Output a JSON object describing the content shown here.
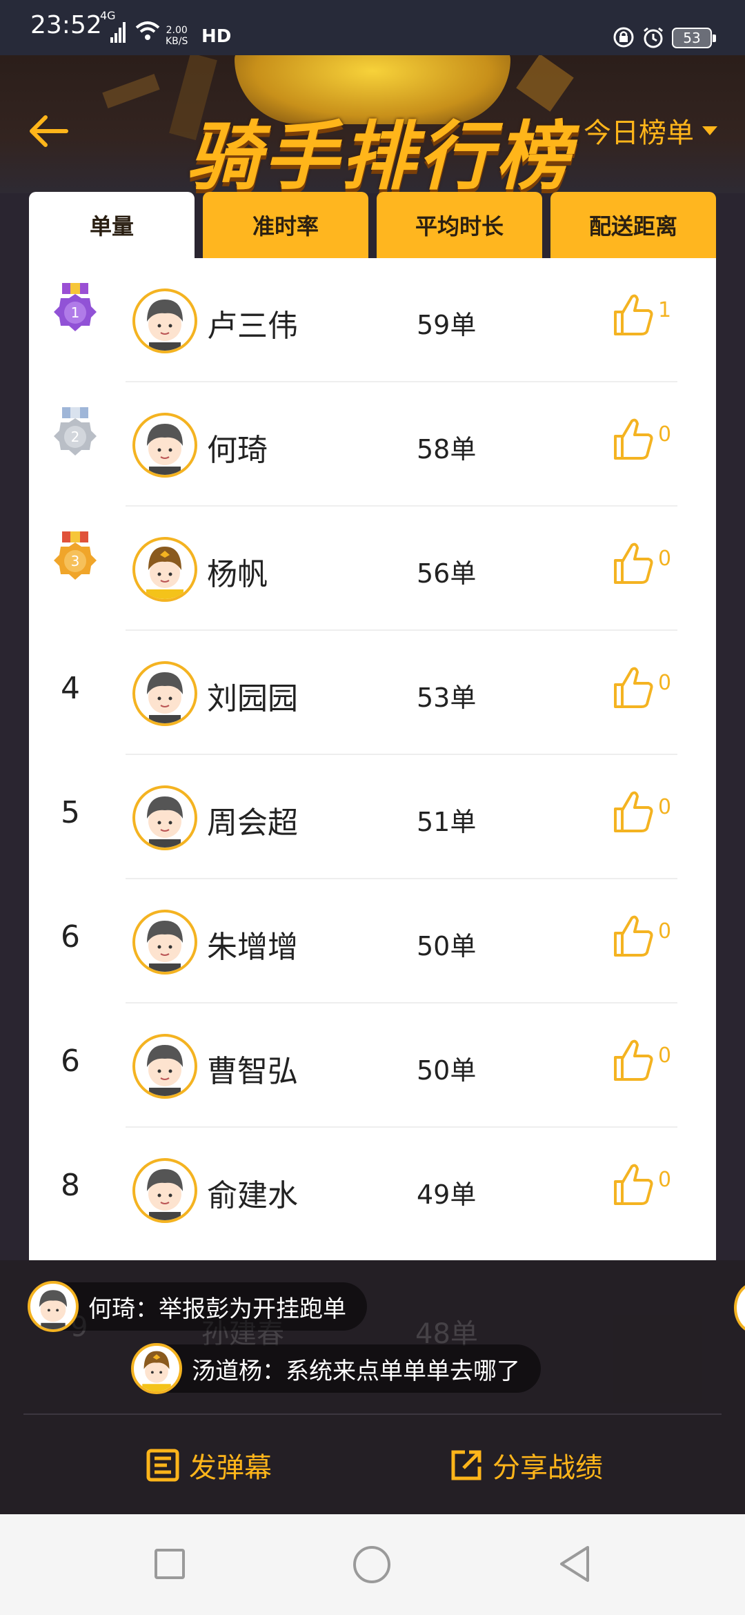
{
  "status_bar": {
    "time": "23:52",
    "network": "4G",
    "speed_value": "2.00",
    "speed_unit": "KB/S",
    "hd": "HD",
    "battery": "53"
  },
  "header": {
    "title": "骑手排行榜",
    "period_dropdown": "今日榜单"
  },
  "tabs": [
    {
      "label": "单量",
      "active": true
    },
    {
      "label": "准时率",
      "active": false
    },
    {
      "label": "平均时长",
      "active": false
    },
    {
      "label": "配送距离",
      "active": false
    }
  ],
  "riders": [
    {
      "rank": "1",
      "medal": "purple",
      "name": "卢三伟",
      "orders": "59单",
      "likes": "1"
    },
    {
      "rank": "2",
      "medal": "silver",
      "name": "何琦",
      "orders": "58单",
      "likes": "0"
    },
    {
      "rank": "3",
      "medal": "gold",
      "name": "杨帆",
      "orders": "56单",
      "likes": "0"
    },
    {
      "rank": "4",
      "medal": "",
      "name": "刘园园",
      "orders": "53单",
      "likes": "0"
    },
    {
      "rank": "5",
      "medal": "",
      "name": "周会超",
      "orders": "51单",
      "likes": "0"
    },
    {
      "rank": "6",
      "medal": "",
      "name": "朱增增",
      "orders": "50单",
      "likes": "0"
    },
    {
      "rank": "6",
      "medal": "",
      "name": "曹智弘",
      "orders": "50单",
      "likes": "0"
    },
    {
      "rank": "8",
      "medal": "",
      "name": "俞建水",
      "orders": "49单",
      "likes": "0"
    }
  ],
  "partial_row": {
    "rank": "9",
    "name": "孙建春",
    "orders": "48单"
  },
  "danmaku": [
    {
      "text": "何琦：举报彭为开挂跑单"
    },
    {
      "text": "汤道杨：系统来点单单单去哪了"
    }
  ],
  "actions": {
    "send_danmaku": "发弹幕",
    "share": "分享战绩"
  },
  "colors": {
    "accent": "#ffb61f",
    "like": "#f4b321"
  }
}
